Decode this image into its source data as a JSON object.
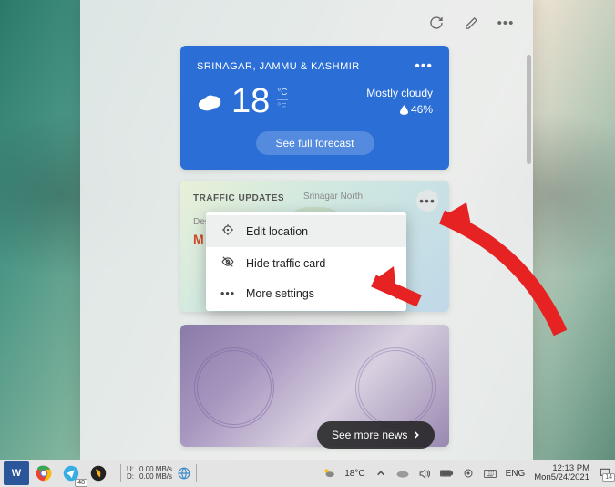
{
  "weather": {
    "location": "SRINAGAR, JAMMU & KASHMIR",
    "temp": "18",
    "unit_c": "°C",
    "unit_f": "°F",
    "condition": "Mostly cloudy",
    "humidity": "46%",
    "forecast_btn": "See full forecast"
  },
  "traffic": {
    "title": "TRAFFIC UPDATES",
    "map_label": "Srinagar North",
    "destination_label": "Destination",
    "m": "M"
  },
  "menu": {
    "edit": "Edit location",
    "hide": "Hide traffic card",
    "more": "More settings"
  },
  "news": {
    "see_more": "See more news"
  },
  "taskbar": {
    "net_up_label": "U:",
    "net_dn_label": "D:",
    "net_up": "0.00 MB/s",
    "net_dn": "0.00 MB/s",
    "badge": "48",
    "weather_temp": "18°C",
    "lang": "ENG",
    "time": "12:13 PM",
    "date": "Mon5/24/2021",
    "notif_count": "14"
  }
}
